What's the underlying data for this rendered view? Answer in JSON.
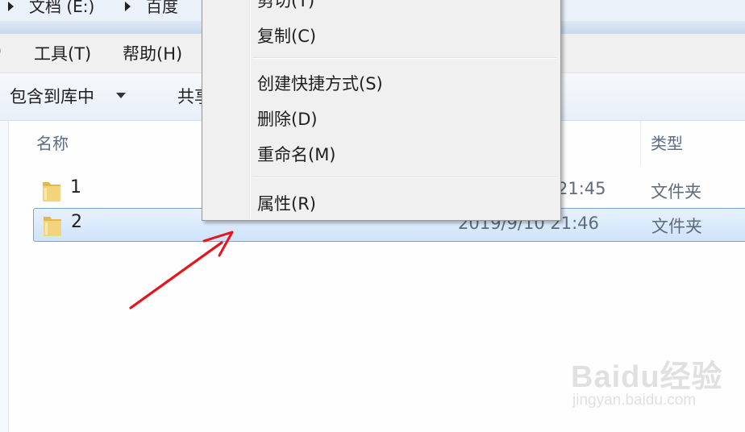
{
  "address_bar": {
    "crumbs": [
      "文档 (E:)",
      "百度"
    ]
  },
  "menu_bar": {
    "items": [
      ")",
      "工具(T)",
      "帮助(H)"
    ]
  },
  "toolbar": {
    "include_library_label": "包含到库中",
    "share_label": "共享"
  },
  "file_list": {
    "columns": {
      "name": "名称",
      "type": "类型"
    },
    "rows": [
      {
        "name": "1",
        "date_modified": "21:45",
        "type": "文件夹",
        "selected": false
      },
      {
        "name": "2",
        "date_modified": "2019/9/10 21:46",
        "type": "文件夹",
        "selected": true
      }
    ]
  },
  "context_menu": {
    "items": [
      {
        "label": "剪切(T)"
      },
      {
        "label": "复制(C)"
      },
      {
        "label": "创建快捷方式(S)"
      },
      {
        "label": "删除(D)"
      },
      {
        "label": "重命名(M)"
      },
      {
        "label": "属性(R)"
      }
    ]
  },
  "watermark": {
    "brand": "Baidu经验",
    "site": "jingyan.baidu.com"
  },
  "colors": {
    "selection_fill": "#cfe3fb",
    "selection_border": "#7da2ce",
    "annotation_arrow": "#e8141c",
    "folder": "#e8c560"
  },
  "icons": [
    "folder-icon",
    "dropdown-caret-icon",
    "breadcrumb-arrow-icon",
    "red-arrow-annotation"
  ]
}
